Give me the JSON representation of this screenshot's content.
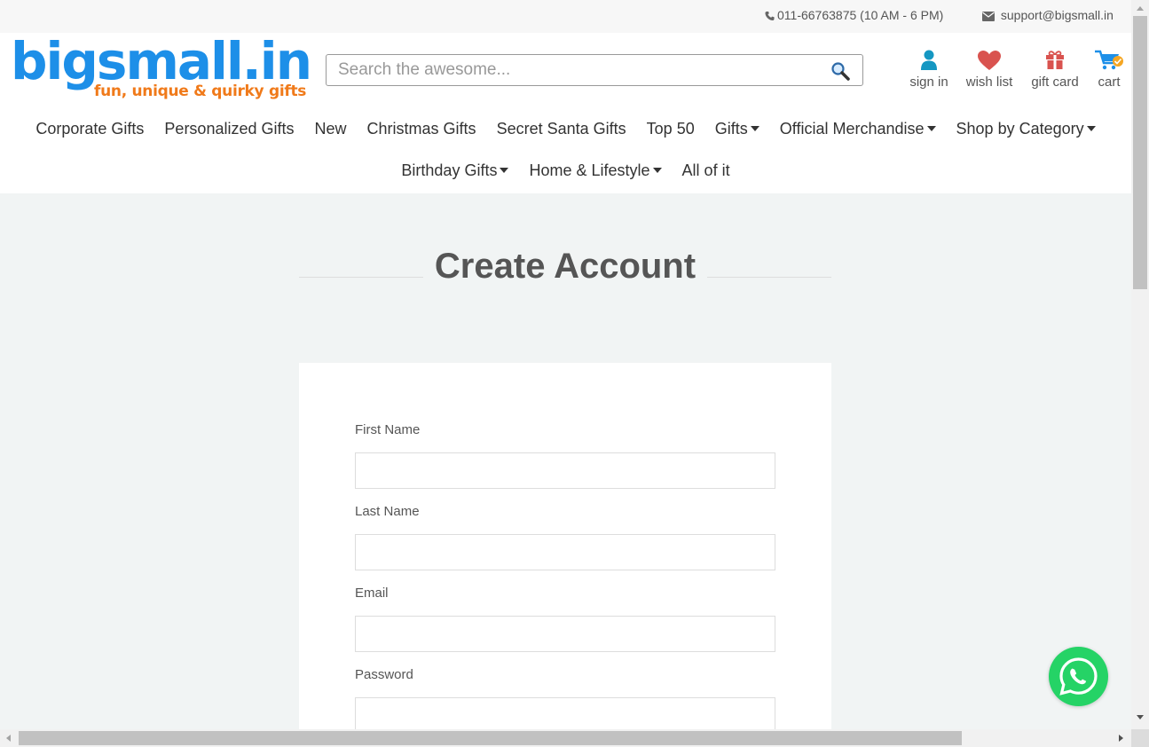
{
  "topbar": {
    "phone": "011-66763875 (10 AM - 6 PM)",
    "email": "support@bigsmall.in"
  },
  "logo": {
    "brand": "bigsmall.in",
    "tagline": "fun, unique & quirky gifts",
    "brand_color": "#1d8fe8",
    "tagline_color": "#f07a1a"
  },
  "search": {
    "placeholder": "Search the awesome...",
    "value": ""
  },
  "header_links": {
    "sign_in": "sign in",
    "wish_list": "wish list",
    "gift_card": "gift card",
    "cart": "cart"
  },
  "nav": {
    "row1": [
      {
        "label": "Corporate Gifts"
      },
      {
        "label": "Personalized Gifts"
      },
      {
        "label": "New"
      },
      {
        "label": "Christmas Gifts"
      },
      {
        "label": "Secret Santa Gifts"
      },
      {
        "label": "Top 50"
      },
      {
        "label": "Gifts"
      },
      {
        "label": "Official Merchandise"
      },
      {
        "label": "Shop by Category"
      }
    ],
    "row2": [
      {
        "label": "Birthday Gifts"
      },
      {
        "label": "Home & Lifestyle"
      },
      {
        "label": "All of it"
      }
    ]
  },
  "page": {
    "title": "Create Account"
  },
  "form": {
    "first_name_label": "First Name",
    "last_name_label": "Last Name",
    "email_label": "Email",
    "password_label": "Password",
    "first_name_value": "",
    "last_name_value": "",
    "email_value": "",
    "password_value": ""
  },
  "colors": {
    "page_bg": "#f1f4f4",
    "whatsapp": "#25d366",
    "signin_icon": "#1597c2",
    "wish_icon": "#d9534f",
    "gift_icon": "#d9534f"
  },
  "icons": {
    "phone": "phone-icon",
    "email": "envelope-icon",
    "search": "magnifier-icon",
    "sign_in": "user-icon",
    "wish_list": "heart-icon",
    "gift_card": "gift-icon",
    "cart": "cart-icon",
    "whatsapp": "whatsapp-icon"
  }
}
